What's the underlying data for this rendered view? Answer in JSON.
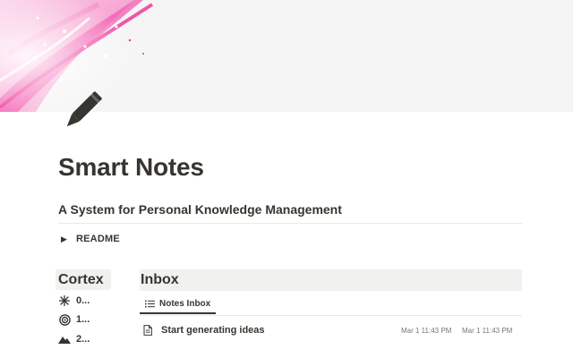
{
  "cover": {
    "name": "pink-abstract-cover",
    "accent": "#f0389a"
  },
  "page": {
    "icon": "pencil-icon",
    "title": "Smart Notes",
    "subtitle": "A System for Personal Knowledge Management"
  },
  "readme": {
    "label": "README",
    "icon": "triangle-right-icon"
  },
  "cortex": {
    "heading": "Cortex",
    "items": [
      {
        "label": "0...",
        "icon": "asterisk-icon"
      },
      {
        "label": "1...",
        "icon": "target-icon"
      },
      {
        "label": "2...",
        "icon": "mountains-icon"
      }
    ]
  },
  "inbox": {
    "heading": "Inbox",
    "view_tab": {
      "label": "Notes Inbox",
      "icon": "list-icon"
    },
    "rows": [
      {
        "name": "Start generating ideas",
        "icon": "document-icon",
        "created": "Mar 1 11:43 PM",
        "edited": "Mar 1 11:43 PM"
      }
    ]
  }
}
